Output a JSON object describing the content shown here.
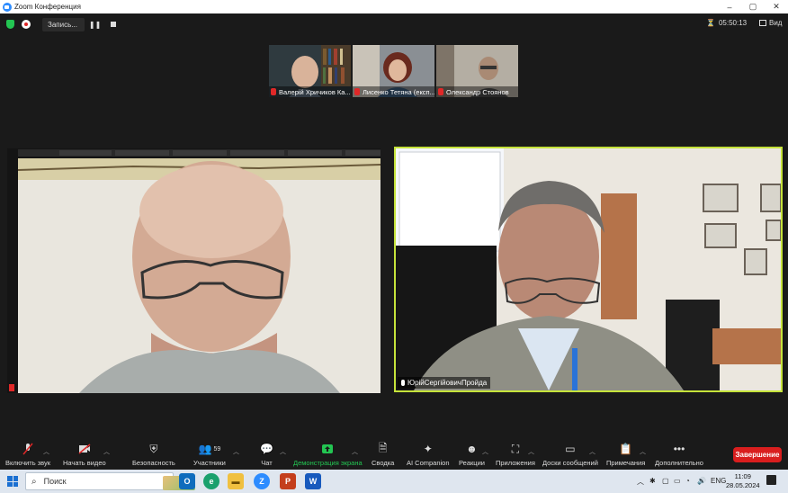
{
  "window": {
    "title": "Zoom Конференция",
    "controls": [
      "–",
      "▢",
      "✕"
    ]
  },
  "meeting": {
    "recording_label": "Запись...",
    "timer": "05:50:13",
    "view_label": "Вид"
  },
  "thumbnails": [
    {
      "name": "Валерій Хричиков Ка..."
    },
    {
      "name": "Лисенко Тетяна (експ..."
    },
    {
      "name": "Олександр Стоянов"
    }
  ],
  "videos": {
    "right_speaker": "ЮрійСергійовичПройда"
  },
  "toolbar": {
    "items": [
      {
        "label": "Включить звук",
        "icon": "mic-muted-icon"
      },
      {
        "label": "Начать видео",
        "icon": "video-off-icon"
      },
      {
        "label": "Безопасность",
        "icon": "shield-icon"
      },
      {
        "label": "Участники",
        "icon": "participants-icon",
        "count": "59"
      },
      {
        "label": "Чат",
        "icon": "chat-icon"
      },
      {
        "label": "Демонстрация экрана",
        "icon": "share-screen-icon"
      },
      {
        "label": "Сводка",
        "icon": "summary-icon"
      },
      {
        "label": "AI Companion",
        "icon": "ai-sparkle-icon"
      },
      {
        "label": "Реакции",
        "icon": "reactions-icon"
      },
      {
        "label": "Приложения",
        "icon": "apps-icon"
      },
      {
        "label": "Доски сообщений",
        "icon": "whiteboard-icon"
      },
      {
        "label": "Примечания",
        "icon": "notes-icon"
      },
      {
        "label": "Дополнительно",
        "icon": "more-icon"
      }
    ],
    "end_label": "Завершение"
  },
  "taskbar": {
    "search_placeholder": "Поиск",
    "language": "ENG",
    "time": "11:09",
    "date": "28.05.2024"
  },
  "colors": {
    "active_speaker_border": "#c5e33a",
    "share_green": "#23c552",
    "end_red": "#d91e1e"
  }
}
